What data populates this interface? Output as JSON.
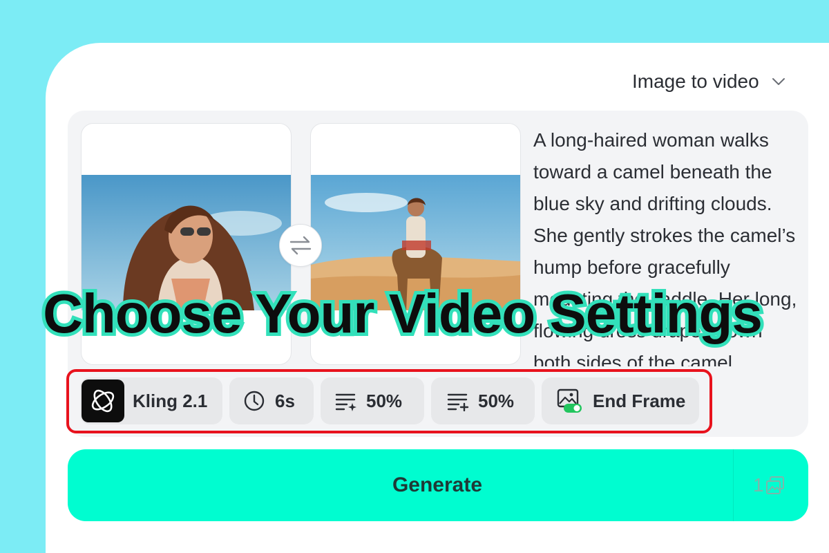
{
  "mode_selector": {
    "label": "Image to video",
    "icon": "chevron-down-icon"
  },
  "frames": {
    "start": {
      "icon": "portrait-photo"
    },
    "end": {
      "icon": "desert-camel-photo"
    },
    "swap_icon": "swap-arrows-icon"
  },
  "prompt": {
    "text": "A long-haired woman walks toward a camel beneath the blue sky and drifting clouds. She gently strokes the camel’s hump before gracefully mounting the saddle. Her long, flowing dress drapes down both sides of the camel."
  },
  "overlay_title": "Choose Your Video Settings",
  "settings": {
    "model": {
      "label": "Kling 2.1",
      "icon": "kling-logo-icon"
    },
    "duration": {
      "label": "6s",
      "icon": "clock-icon"
    },
    "param1": {
      "label": "50%",
      "icon": "list-sparkle-icon"
    },
    "param2": {
      "label": "50%",
      "icon": "list-plus-icon"
    },
    "end_frame": {
      "label": "End Frame",
      "icon": "image-toggle-icon"
    }
  },
  "generate": {
    "label": "Generate",
    "credit": "1",
    "credit_icon": "image-stack-icon"
  },
  "colors": {
    "background": "#7cecf5",
    "accent": "#00fdd0",
    "title_outline": "#32e0ba",
    "highlight": "#e8121d",
    "toggle_on": "#22c55e"
  }
}
